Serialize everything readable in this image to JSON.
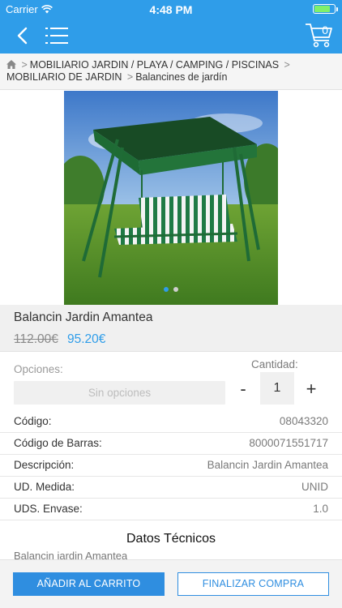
{
  "status_bar": {
    "carrier": "Carrier",
    "time": "4:48 PM",
    "battery_level": 0.8
  },
  "nav": {
    "cart_count": "0"
  },
  "breadcrumb": {
    "items": [
      "MOBILIARIO JARDIN / PLAYA / CAMPING / PISCINAS",
      "MOBILIARIO DE JARDIN",
      "Balancines de jardín"
    ],
    "separator": ">"
  },
  "gallery": {
    "image_count": 2,
    "active_index": 0
  },
  "product": {
    "name": "Balancin  Jardin Amantea",
    "old_price": "112.00€",
    "price": "95.20€"
  },
  "options": {
    "label": "Opciones:",
    "value": "Sin opciones"
  },
  "quantity": {
    "label": "Cantidad:",
    "minus": "-",
    "value": "1",
    "plus": "+"
  },
  "details": [
    {
      "key": "Código:",
      "value": "08043320"
    },
    {
      "key": "Código de Barras:",
      "value": "8000071551717"
    },
    {
      "key": "Descripción:",
      "value": "Balancin  Jardin Amantea"
    },
    {
      "key": "UD. Medida:",
      "value": "UNID"
    },
    {
      "key": "UDS. Envase:",
      "value": "1.0"
    }
  ],
  "tech": {
    "title": "Datos Técnicos",
    "text": "Balancin jardin Amantea"
  },
  "actions": {
    "add_to_cart": "AÑADIR AL CARRITO",
    "finish": "FINALIZAR COMPRA"
  },
  "colors": {
    "accent": "#2f9de9",
    "button": "#2f8ee0"
  }
}
